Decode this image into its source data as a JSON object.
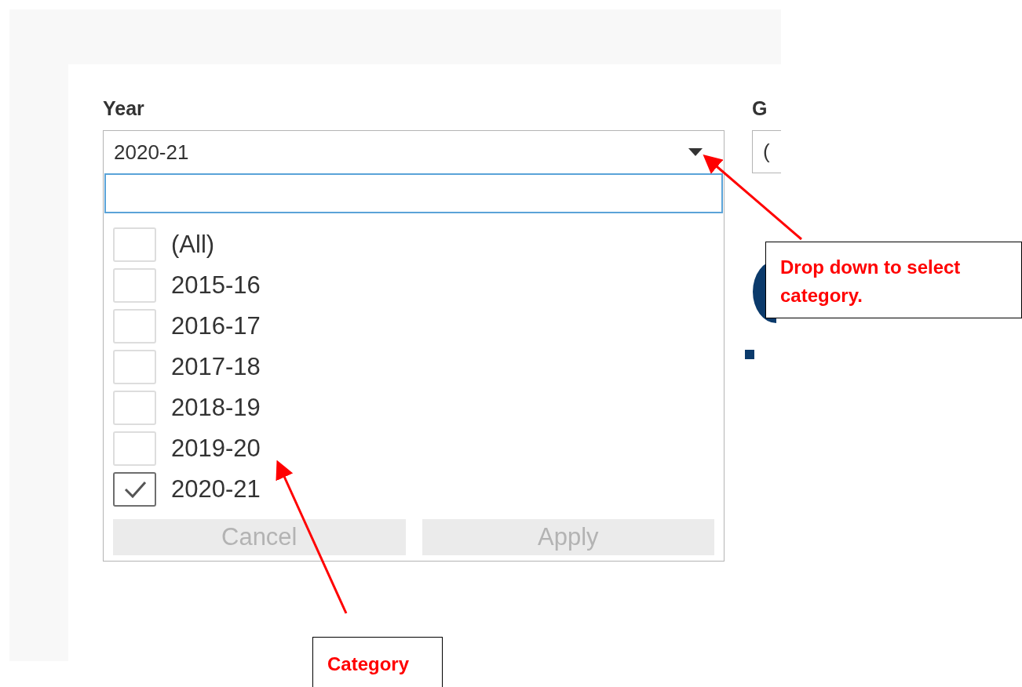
{
  "filters": [
    {
      "label": "Year",
      "value": "2020-21",
      "expanded": true,
      "options": [
        {
          "label": "(All)",
          "checked": false
        },
        {
          "label": "2015-16",
          "checked": false
        },
        {
          "label": "2016-17",
          "checked": false
        },
        {
          "label": "2017-18",
          "checked": false
        },
        {
          "label": "2018-19",
          "checked": false
        },
        {
          "label": "2019-20",
          "checked": false
        },
        {
          "label": "2020-21",
          "checked": true
        }
      ],
      "buttons": [
        {
          "label": "Cancel",
          "disabled": true
        },
        {
          "label": "Apply",
          "disabled": true
        }
      ]
    },
    {
      "label": "G",
      "value": "(",
      "expanded": false
    }
  ],
  "annotations": [
    {
      "text": "Drop down to select category."
    },
    {
      "text": "Category"
    }
  ]
}
